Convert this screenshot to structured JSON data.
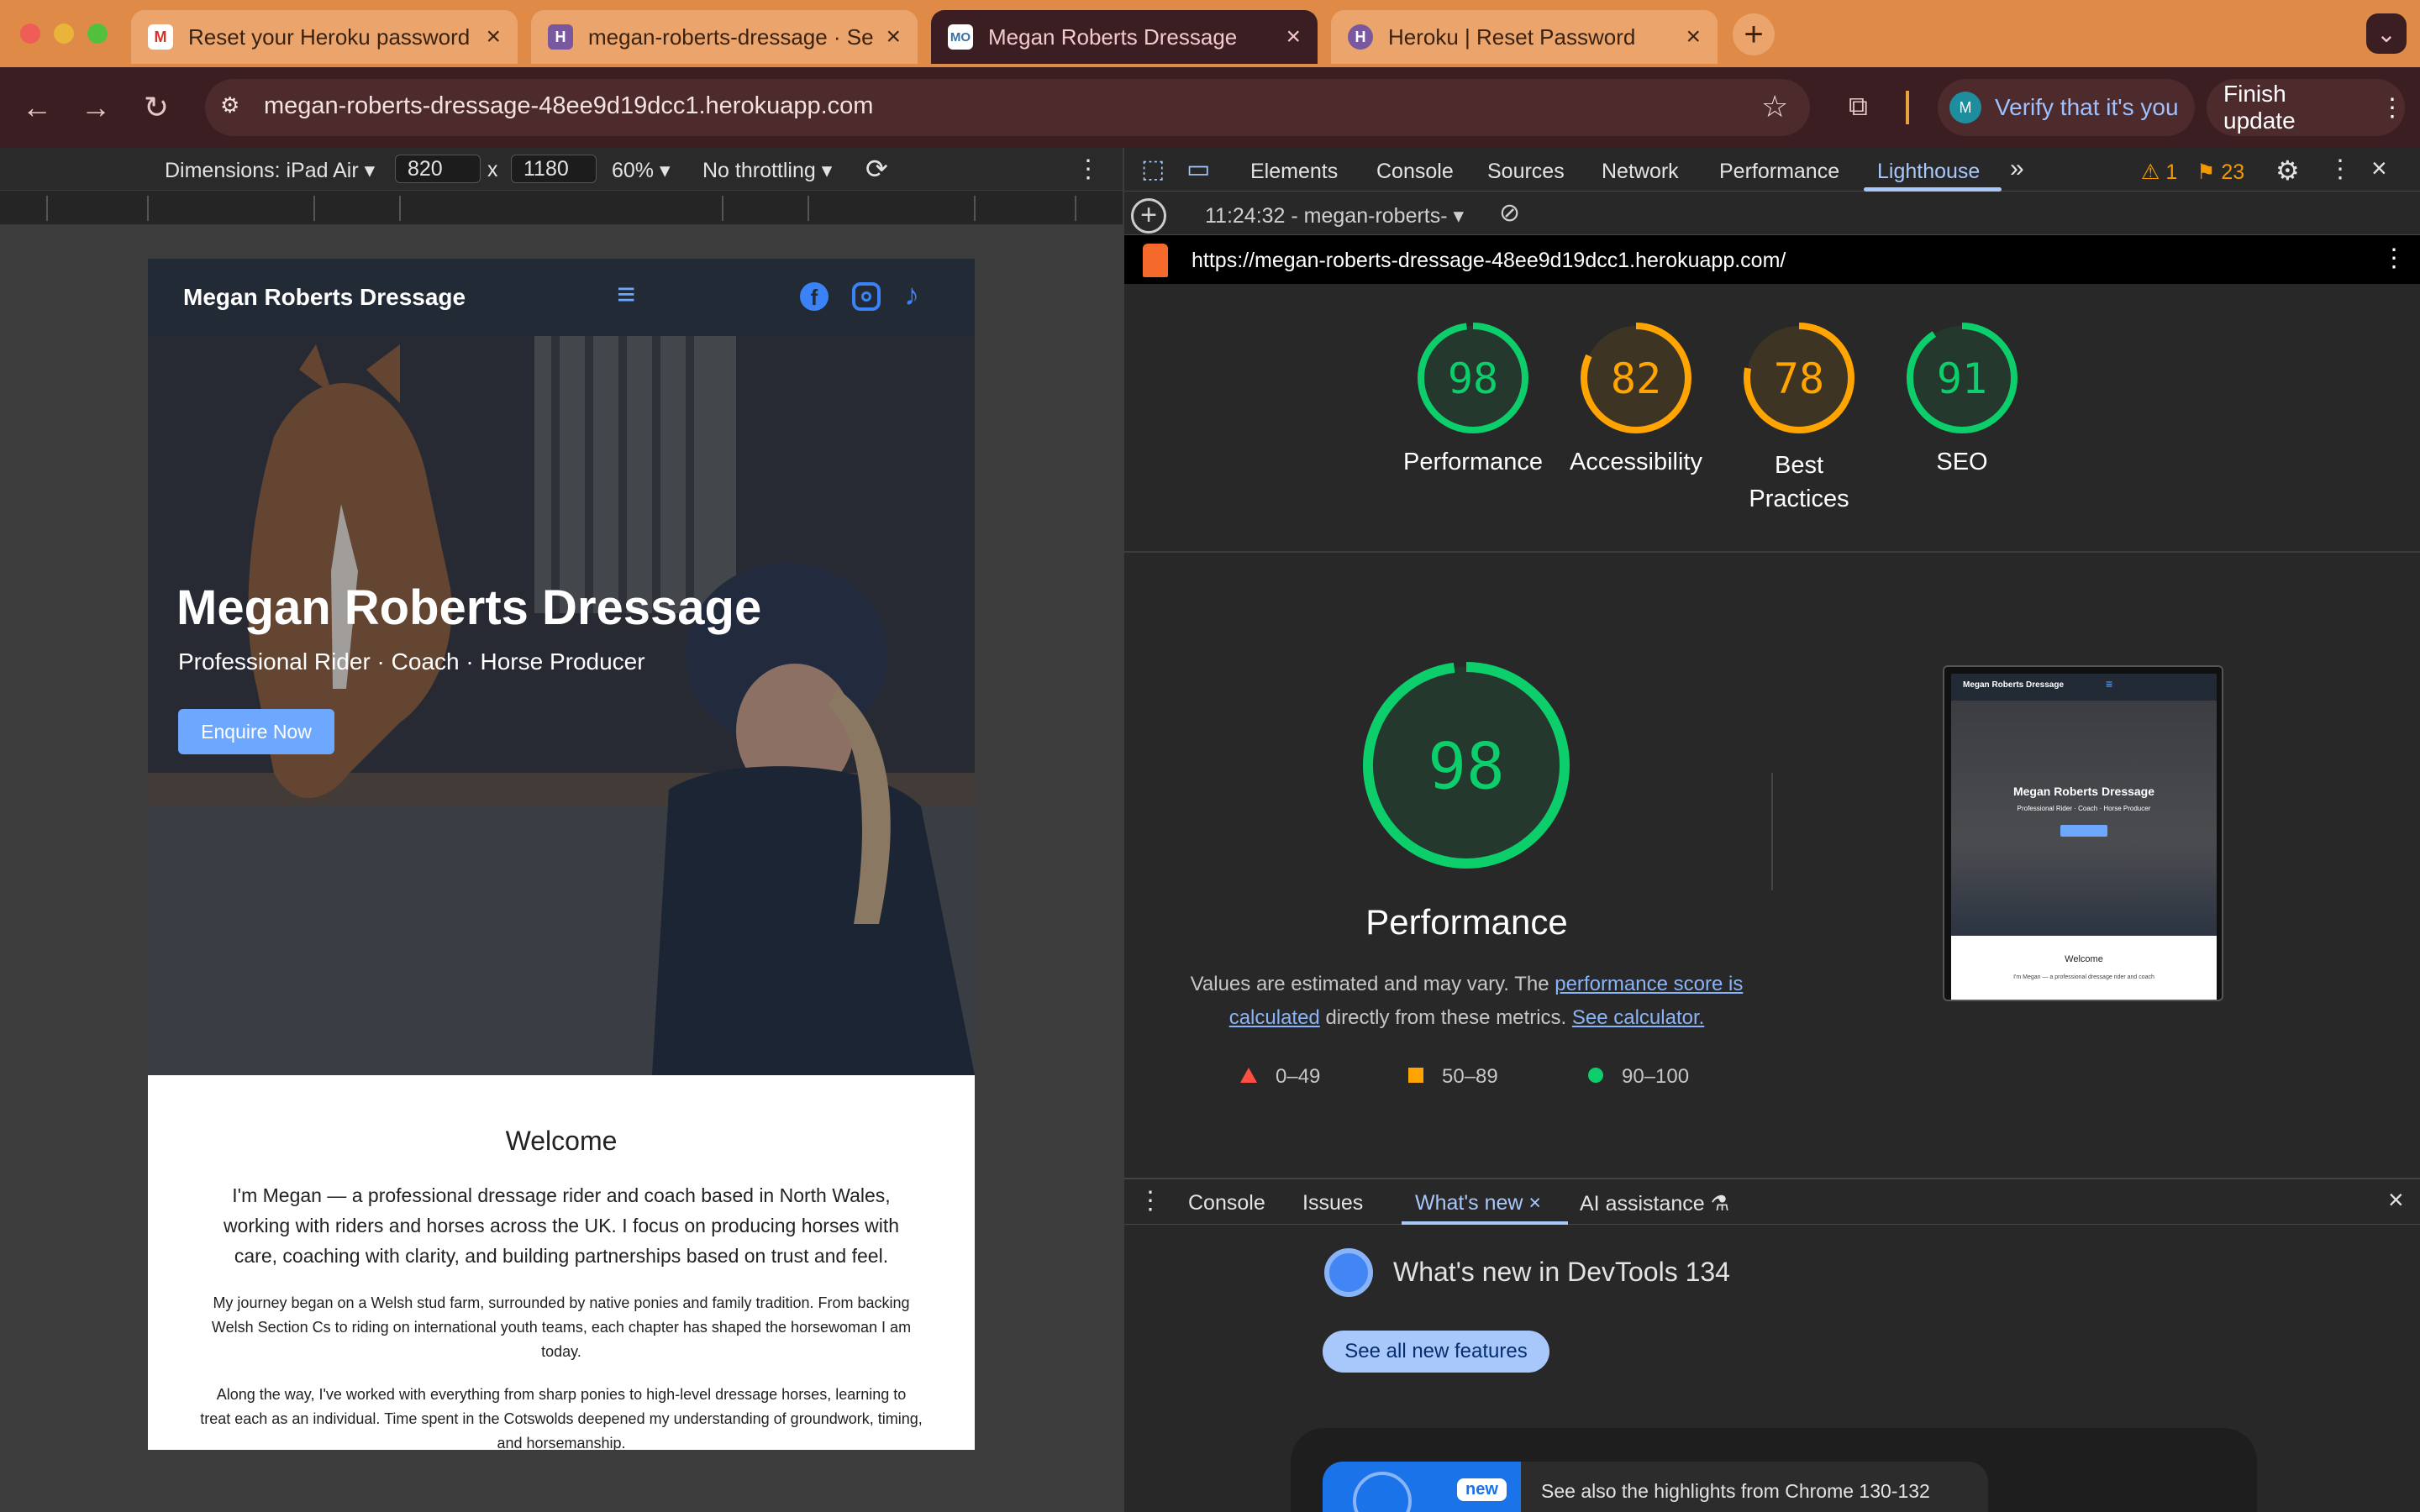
{
  "tabs": [
    {
      "title": "Reset your Heroku password",
      "icon": "gmail-icon"
    },
    {
      "title": "megan-roberts-dressage · Se",
      "icon": "heroku-icon"
    },
    {
      "title": "Megan Roberts Dressage",
      "icon": "site-favicon",
      "favicon_text": "MO"
    },
    {
      "title": "Heroku | Reset Password",
      "icon": "heroku-icon"
    }
  ],
  "toolbar": {
    "url": "megan-roberts-dressage-48ee9d19dcc1.herokuapp.com",
    "verify_label": "Verify that it's you",
    "avatar_initial": "M",
    "finish_label": "Finish update"
  },
  "device": {
    "dimensions_label": "Dimensions: iPad Air",
    "width": "820",
    "times": "x",
    "height": "1180",
    "zoom": "60%",
    "throttle": "No throttling"
  },
  "site": {
    "brand": "Megan Roberts Dressage",
    "hero_title": "Megan Roberts Dressage",
    "hero_subtitle": "Professional Rider · Coach · Horse Producer",
    "cta": "Enquire Now",
    "welcome_heading": "Welcome",
    "welcome_lead": "I'm Megan — a professional dressage rider and coach based in North Wales, working with riders and horses across the UK. I focus on producing horses with care, coaching with clarity, and building partnerships based on trust and feel.",
    "para1": "My journey began on a Welsh stud farm, surrounded by native ponies and family tradition. From backing Welsh Section Cs to riding on international youth teams, each chapter has shaped the horsewoman I am today.",
    "para2": "Along the way, I've worked with everything from sharp ponies to high-level dressage horses, learning to treat each as an individual. Time spent in the Cotswolds deepened my understanding of groundwork, timing, and horsemanship."
  },
  "devtools": {
    "tabs": [
      "Elements",
      "Console",
      "Sources",
      "Network",
      "Performance",
      "Lighthouse"
    ],
    "active_tab": "Lighthouse",
    "warnings": "1",
    "issues": "23",
    "report_time": "11:24:32 - megan-roberts-",
    "report_url": "https://megan-roberts-dressage-48ee9d19dcc1.herokuapp.com/"
  },
  "lighthouse": {
    "scores": [
      {
        "name": "Performance",
        "value": 98,
        "color": "#0cce6b"
      },
      {
        "name": "Accessibility",
        "value": 82,
        "color": "#ffa400"
      },
      {
        "name": "Best Practices",
        "value": 78,
        "color": "#ffa400"
      },
      {
        "name": "SEO",
        "value": 91,
        "color": "#0cce6b"
      }
    ],
    "main_score": 98,
    "main_label": "Performance",
    "note_pre": "Values are estimated and may vary. The",
    "note_link1": "performance score is calculated",
    "note_mid": "directly from these metrics.",
    "note_link2": "See calculator.",
    "legend": [
      {
        "range": "0–49",
        "color": "#ff4e42",
        "shape": "triangle"
      },
      {
        "range": "50–89",
        "color": "#ffa400",
        "shape": "square"
      },
      {
        "range": "90–100",
        "color": "#0cce6b",
        "shape": "circle"
      }
    ],
    "thumb": {
      "brand": "Megan Roberts Dressage",
      "title": "Megan Roberts Dressage",
      "subtitle": "Professional Rider · Coach · Horse Producer",
      "welcome": "Welcome",
      "lead": "I'm Megan — a professional dressage rider and coach"
    }
  },
  "drawer": {
    "tabs": [
      "Console",
      "Issues",
      "What's new",
      "AI assistance"
    ],
    "active_tab": "What's new",
    "heading": "What's new in DevTools 134",
    "button": "See all new features",
    "badge": "new",
    "highlight": "See also the highlights from Chrome 130-132"
  }
}
